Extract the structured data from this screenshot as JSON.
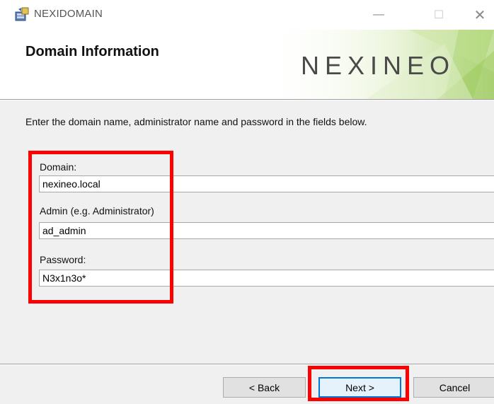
{
  "window": {
    "title": "NEXIDOMAIN",
    "minimize_glyph": "—",
    "maximize_glyph": "☐",
    "close_glyph": "✕"
  },
  "banner": {
    "title": "Domain Information",
    "brand": "NEXINEO"
  },
  "instructions": "Enter the domain name, administrator name and password in the fields below.",
  "form": {
    "domain": {
      "label": "Domain:",
      "value": "nexineo.local"
    },
    "admin": {
      "label": "Admin (e.g. Administrator)",
      "value": "ad_admin"
    },
    "password": {
      "label": "Password:",
      "value": "N3x1n3o*"
    }
  },
  "buttons": {
    "back": "< Back",
    "next": "Next >",
    "cancel": "Cancel"
  },
  "colors": {
    "highlight": "#ff0000",
    "focus_border": "#0078d7",
    "banner_accent": "#8dc63f"
  }
}
